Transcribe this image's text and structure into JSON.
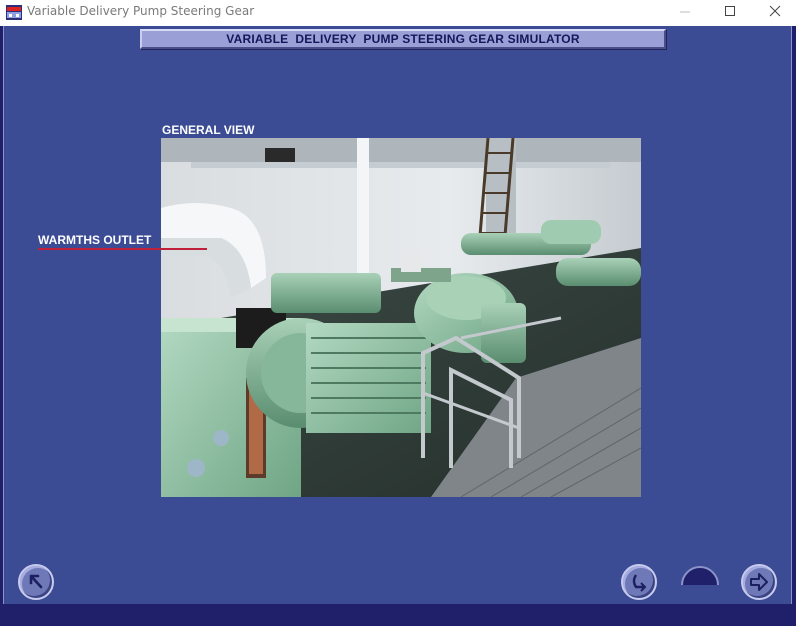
{
  "window": {
    "title": "Variable Delivery Pump Steering Gear",
    "icon": "app-ship-icon",
    "controls": {
      "minimize": "minimize-icon",
      "maximize": "maximize-icon",
      "close": "close-icon"
    }
  },
  "header": {
    "title": "VARIABLE  DELIVERY  PUMP STEERING GEAR SIMULATOR"
  },
  "photo": {
    "caption": "GENERAL VIEW",
    "subject": "steering-gear-machinery-photo"
  },
  "callouts": [
    {
      "label": "WARMTHS OUTLET",
      "line_color": "#c0203a"
    }
  ],
  "navigation": {
    "back_icon": "back-arrow-icon",
    "menu_icon": "home-menu-icon",
    "next_icon": "next-arrow-icon"
  },
  "colors": {
    "background": "#3b4b94",
    "frame": "#1f1f6a",
    "header_bar": "#9aa0d6",
    "header_text": "#14175a",
    "label_text": "#ffffff"
  }
}
